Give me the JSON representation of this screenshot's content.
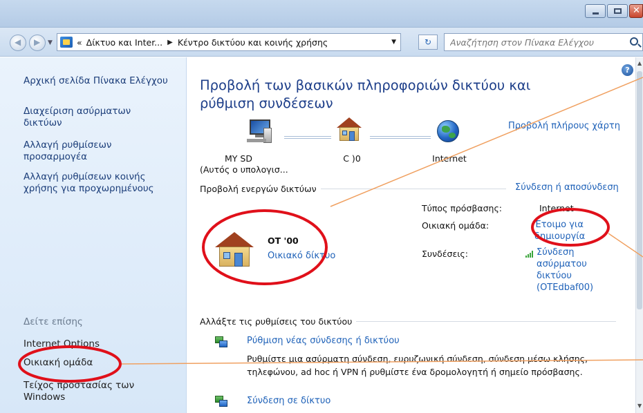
{
  "breadcrumb": {
    "segments": [
      "Δίκτυο και Inter...",
      "Κέντρο δικτύου και κοινής χρήσης"
    ],
    "back_glyph": "«"
  },
  "search": {
    "placeholder": "Αναζήτηση στον Πίνακα Ελέγχου"
  },
  "sidebar": {
    "items": [
      "Αρχική σελίδα Πίνακα Ελέγχου",
      "Διαχείριση ασύρματων δικτύων",
      "Αλλαγή ρυθμίσεων προσαρμογέα",
      "Αλλαγή ρυθμίσεων κοινής χρήσης για προχωρημένους"
    ],
    "see_also": "Δείτε επίσης",
    "see_also_items": [
      "Internet Options",
      "Οικιακή ομάδα",
      "Τείχος προστασίας των Windows"
    ]
  },
  "main": {
    "title": "Προβολή των βασικών πληροφοριών δικτύου και ρύθμιση συνδέσεων",
    "full_map_link": "Προβολή πλήρους χάρτη",
    "map": {
      "pc_name": "MY      SD",
      "pc_sub": "(Αυτός ο υπολογισ...",
      "network_name": "C          )0",
      "internet": "Internet"
    },
    "active_networks_heading": "Προβολή ενεργών δικτύων",
    "connect_link": "Σύνδεση ή αποσύνδεση",
    "network": {
      "name": "OT        '00",
      "type": "Οικιακό δίκτυο"
    },
    "props": {
      "access_type_label": "Τύπος πρόσβασης:",
      "access_type_value": "Internet",
      "homegroup_label": "Οικιακή ομάδα:",
      "homegroup_value": "Έτοιμο για δημιουργία",
      "connections_label": "Συνδέσεις:",
      "connections_value": "Σύνδεση ασύρματου δικτύου (OTEdbaf00)"
    },
    "change_settings_heading": "Αλλάξτε τις ρυθμίσεις του δικτύου",
    "tasks": [
      {
        "title": "Ρύθμιση νέας σύνδεσης ή δικτύου",
        "desc": "Ρυθμίστε μια ασύρματη σύνδεση, ευρυζωνική σύνδεση, σύνδεση μέσω κλήσης, τηλεφώνου, ad hoc ή VPN ή ρυθμίστε ένα δρομολογητή ή σημείο πρόσβασης."
      },
      {
        "title": "Σύνδεση σε δίκτυο"
      }
    ]
  },
  "colors": {
    "accent_link": "#1e61b8",
    "title": "#1e3f8a",
    "annotation_red": "#e0101a",
    "annotation_line": "#f0a060"
  }
}
